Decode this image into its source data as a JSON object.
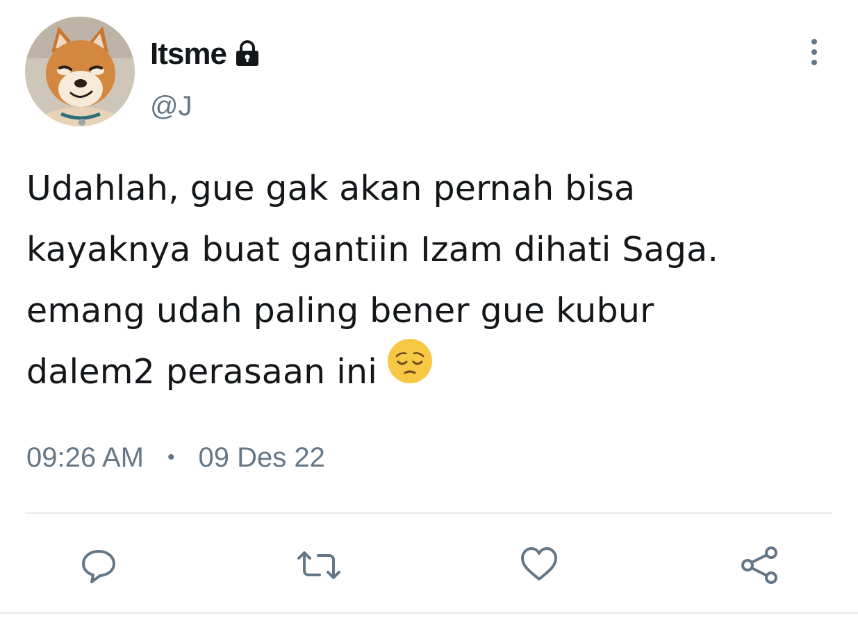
{
  "author": {
    "display_name": "Itsme",
    "handle": "@J",
    "avatar_icon": "shiba-inu-dog-avatar",
    "lock_icon": "lock-icon"
  },
  "tweet": {
    "lines": [
      "Udahlah, gue gak akan pernah bisa",
      "kayaknya buat gantiin Izam dihati Saga.",
      "emang udah paling bener gue kubur",
      "dalem2 perasaan ini"
    ],
    "emoji": "pensive-face-emoji"
  },
  "meta": {
    "time": "09:26 AM",
    "separator": "•",
    "date": "09 Des 22"
  },
  "actions": [
    {
      "name": "reply",
      "icon": "reply-icon"
    },
    {
      "name": "retweet",
      "icon": "retweet-icon"
    },
    {
      "name": "like",
      "icon": "heart-icon"
    },
    {
      "name": "share",
      "icon": "share-icon"
    }
  ],
  "colors": {
    "text": "#14171a",
    "secondary": "#657786",
    "icon": "#657786",
    "divider": "#e6ecf0",
    "emoji": "#f7c843"
  }
}
